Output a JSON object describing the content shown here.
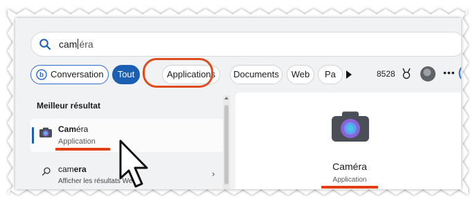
{
  "search": {
    "query_before_caret": "cam",
    "query_after_caret": "éra"
  },
  "filters": {
    "conversation": "Conversation",
    "tout": "Tout",
    "applications": "Applications",
    "documents": "Documents",
    "web": "Web",
    "pa": "Pa",
    "points": "8528"
  },
  "results": {
    "best_label": "Meilleur résultat",
    "best": {
      "title_bold": "Cam",
      "title_rest": "éra",
      "subtitle": "Application"
    },
    "web": {
      "title_prefix": "cam",
      "title_bold": "era",
      "subtitle": "Afficher les résultats Web"
    }
  },
  "detail": {
    "title": "Caméra",
    "subtitle": "Application"
  },
  "colors": {
    "accent": "#1b5fb4",
    "highlight": "#e04b1e",
    "underline": "#e53d12"
  },
  "icons": [
    "search-icon",
    "bing-icon",
    "play-icon",
    "medal-icon",
    "avatar",
    "more-icon",
    "camera-icon",
    "web-search-icon",
    "chevron-right-icon",
    "cursor-arrow-icon"
  ]
}
